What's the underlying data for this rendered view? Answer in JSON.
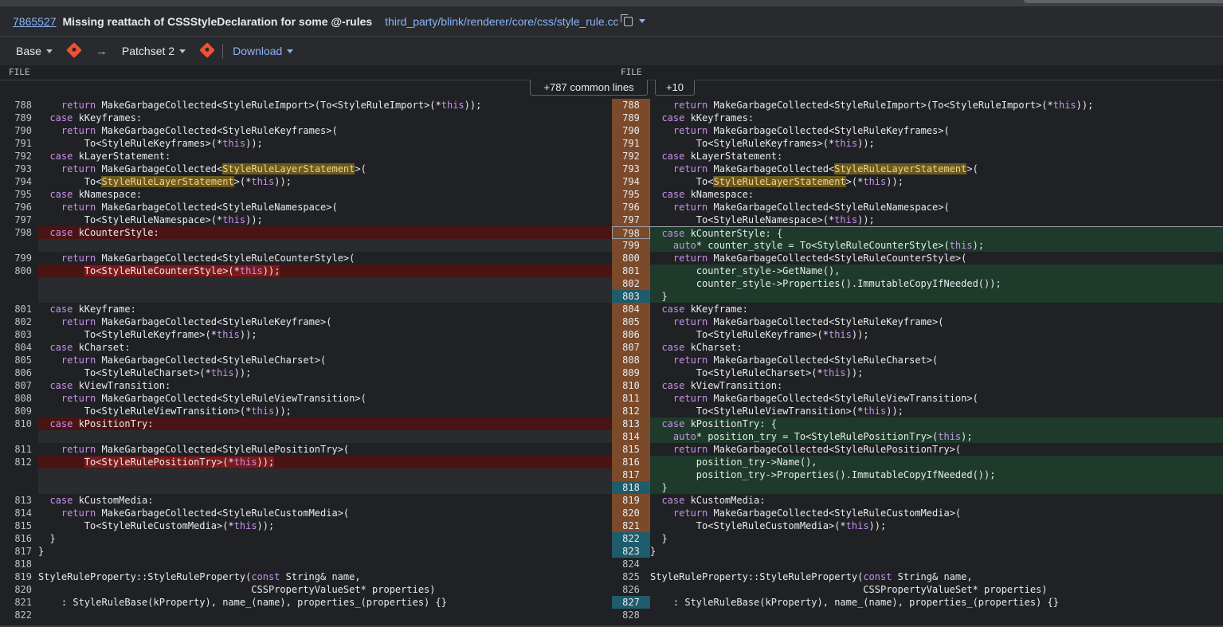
{
  "header": {
    "change_number": "7865527",
    "subject": "Missing reattach of CSSStyleDeclaration for some @-rules",
    "file_path": "third_party/blink/renderer/core/css/style_rule.cc"
  },
  "toolbar": {
    "base_label": "Base",
    "arrow": "→",
    "patchset_label": "Patchset 2",
    "download_label": "Download"
  },
  "file_headers": {
    "left": "FILE",
    "right": "FILE"
  },
  "common_lines": {
    "label": "+787 common lines",
    "more": "+10"
  },
  "colors": {
    "removed": "#4a1414",
    "added": "#1e3a2a",
    "highlight": "#6b5a1e",
    "teal": "#1f5c6b",
    "orange": "#7a4a2a"
  },
  "rows": [
    {
      "type": "eq",
      "l": "788",
      "lt": "    return MakeGarbageCollected<StyleRuleImport>(To<StyleRuleImport>(*this));",
      "r": "788",
      "rt": "    return MakeGarbageCollected<StyleRuleImport>(To<StyleRuleImport>(*this));"
    },
    {
      "type": "eq",
      "l": "789",
      "lt": "  case kKeyframes:",
      "r": "789",
      "rt": "  case kKeyframes:"
    },
    {
      "type": "eq",
      "l": "790",
      "lt": "    return MakeGarbageCollected<StyleRuleKeyframes>(",
      "r": "790",
      "rt": "    return MakeGarbageCollected<StyleRuleKeyframes>("
    },
    {
      "type": "eq",
      "l": "791",
      "lt": "        To<StyleRuleKeyframes>(*this));",
      "r": "791",
      "rt": "        To<StyleRuleKeyframes>(*this));"
    },
    {
      "type": "eq",
      "l": "792",
      "lt": "  case kLayerStatement:",
      "r": "792",
      "rt": "  case kLayerStatement:"
    },
    {
      "type": "eq",
      "l": "793",
      "lt": "    return MakeGarbageCollected<StyleRuleLayerStatement>(",
      "r": "793",
      "rt": "    return MakeGarbageCollected<StyleRuleLayerStatement>("
    },
    {
      "type": "eq",
      "l": "794",
      "lt": "        To<StyleRuleLayerStatement>(*this));",
      "r": "794",
      "rt": "        To<StyleRuleLayerStatement>(*this));"
    },
    {
      "type": "eq",
      "l": "795",
      "lt": "  case kNamespace:",
      "r": "795",
      "rt": "  case kNamespace:"
    },
    {
      "type": "eq",
      "l": "796",
      "lt": "    return MakeGarbageCollected<StyleRuleNamespace>(",
      "r": "796",
      "rt": "    return MakeGarbageCollected<StyleRuleNamespace>("
    },
    {
      "type": "eq",
      "l": "797",
      "lt": "        To<StyleRuleNamespace>(*this));",
      "r": "797",
      "rt": "        To<StyleRuleNamespace>(*this));"
    },
    {
      "type": "mod",
      "l": "798",
      "lt": "  case kCounterStyle:",
      "r": "798",
      "rt": "  case kCounterStyle: {"
    },
    {
      "type": "add",
      "l": "",
      "lt": "",
      "r": "799",
      "rt": "    auto* counter_style = To<StyleRuleCounterStyle>(this);"
    },
    {
      "type": "eq",
      "l": "799",
      "lt": "    return MakeGarbageCollected<StyleRuleCounterStyle>(",
      "r": "800",
      "rt": "    return MakeGarbageCollected<StyleRuleCounterStyle>("
    },
    {
      "type": "mod",
      "l": "800",
      "lt": "        To<StyleRuleCounterStyle>(*this));",
      "r": "801",
      "rt": "        counter_style->GetName(),"
    },
    {
      "type": "add",
      "l": "",
      "lt": "",
      "r": "802",
      "rt": "        counter_style->Properties().ImmutableCopyIfNeeded());"
    },
    {
      "type": "add",
      "l": "",
      "lt": "",
      "r": "803",
      "rt": "  }"
    },
    {
      "type": "eq",
      "l": "801",
      "lt": "  case kKeyframe:",
      "r": "804",
      "rt": "  case kKeyframe:"
    },
    {
      "type": "eq",
      "l": "802",
      "lt": "    return MakeGarbageCollected<StyleRuleKeyframe>(",
      "r": "805",
      "rt": "    return MakeGarbageCollected<StyleRuleKeyframe>("
    },
    {
      "type": "eq",
      "l": "803",
      "lt": "        To<StyleRuleKeyframe>(*this));",
      "r": "806",
      "rt": "        To<StyleRuleKeyframe>(*this));"
    },
    {
      "type": "eq",
      "l": "804",
      "lt": "  case kCharset:",
      "r": "807",
      "rt": "  case kCharset:"
    },
    {
      "type": "eq",
      "l": "805",
      "lt": "    return MakeGarbageCollected<StyleRuleCharset>(",
      "r": "808",
      "rt": "    return MakeGarbageCollected<StyleRuleCharset>("
    },
    {
      "type": "eq",
      "l": "806",
      "lt": "        To<StyleRuleCharset>(*this));",
      "r": "809",
      "rt": "        To<StyleRuleCharset>(*this));"
    },
    {
      "type": "eq",
      "l": "807",
      "lt": "  case kViewTransition:",
      "r": "810",
      "rt": "  case kViewTransition:"
    },
    {
      "type": "eq",
      "l": "808",
      "lt": "    return MakeGarbageCollected<StyleRuleViewTransition>(",
      "r": "811",
      "rt": "    return MakeGarbageCollected<StyleRuleViewTransition>("
    },
    {
      "type": "eq",
      "l": "809",
      "lt": "        To<StyleRuleViewTransition>(*this));",
      "r": "812",
      "rt": "        To<StyleRuleViewTransition>(*this));"
    },
    {
      "type": "mod",
      "l": "810",
      "lt": "  case kPositionTry:",
      "r": "813",
      "rt": "  case kPositionTry: {"
    },
    {
      "type": "add",
      "l": "",
      "lt": "",
      "r": "814",
      "rt": "    auto* position_try = To<StyleRulePositionTry>(this);"
    },
    {
      "type": "eq",
      "l": "811",
      "lt": "    return MakeGarbageCollected<StyleRulePositionTry>(",
      "r": "815",
      "rt": "    return MakeGarbageCollected<StyleRulePositionTry>("
    },
    {
      "type": "mod",
      "l": "812",
      "lt": "        To<StyleRulePositionTry>(*this));",
      "r": "816",
      "rt": "        position_try->Name(),"
    },
    {
      "type": "add",
      "l": "",
      "lt": "",
      "r": "817",
      "rt": "        position_try->Properties().ImmutableCopyIfNeeded());"
    },
    {
      "type": "add",
      "l": "",
      "lt": "",
      "r": "818",
      "rt": "  }"
    },
    {
      "type": "eq",
      "l": "813",
      "lt": "  case kCustomMedia:",
      "r": "819",
      "rt": "  case kCustomMedia:"
    },
    {
      "type": "eq",
      "l": "814",
      "lt": "    return MakeGarbageCollected<StyleRuleCustomMedia>(",
      "r": "820",
      "rt": "    return MakeGarbageCollected<StyleRuleCustomMedia>("
    },
    {
      "type": "eq",
      "l": "815",
      "lt": "        To<StyleRuleCustomMedia>(*this));",
      "r": "821",
      "rt": "        To<StyleRuleCustomMedia>(*this));"
    },
    {
      "type": "eq",
      "l": "816",
      "lt": "  }",
      "r": "822",
      "rt": "  }"
    },
    {
      "type": "eq",
      "l": "817",
      "lt": "}",
      "r": "823",
      "rt": "}"
    },
    {
      "type": "eq",
      "l": "818",
      "lt": "",
      "r": "824",
      "rt": ""
    },
    {
      "type": "eq",
      "l": "819",
      "lt": "StyleRuleProperty::StyleRuleProperty(const String& name,",
      "r": "825",
      "rt": "StyleRuleProperty::StyleRuleProperty(const String& name,"
    },
    {
      "type": "eq",
      "l": "820",
      "lt": "                                     CSSPropertyValueSet* properties)",
      "r": "826",
      "rt": "                                     CSSPropertyValueSet* properties)"
    },
    {
      "type": "eq",
      "l": "821",
      "lt": "    : StyleRuleBase(kProperty), name_(name), properties_(properties) {}",
      "r": "827",
      "rt": "    : StyleRuleBase(kProperty), name_(name), properties_(properties) {}"
    },
    {
      "type": "eq",
      "l": "822",
      "lt": "",
      "r": "828",
      "rt": ""
    }
  ]
}
